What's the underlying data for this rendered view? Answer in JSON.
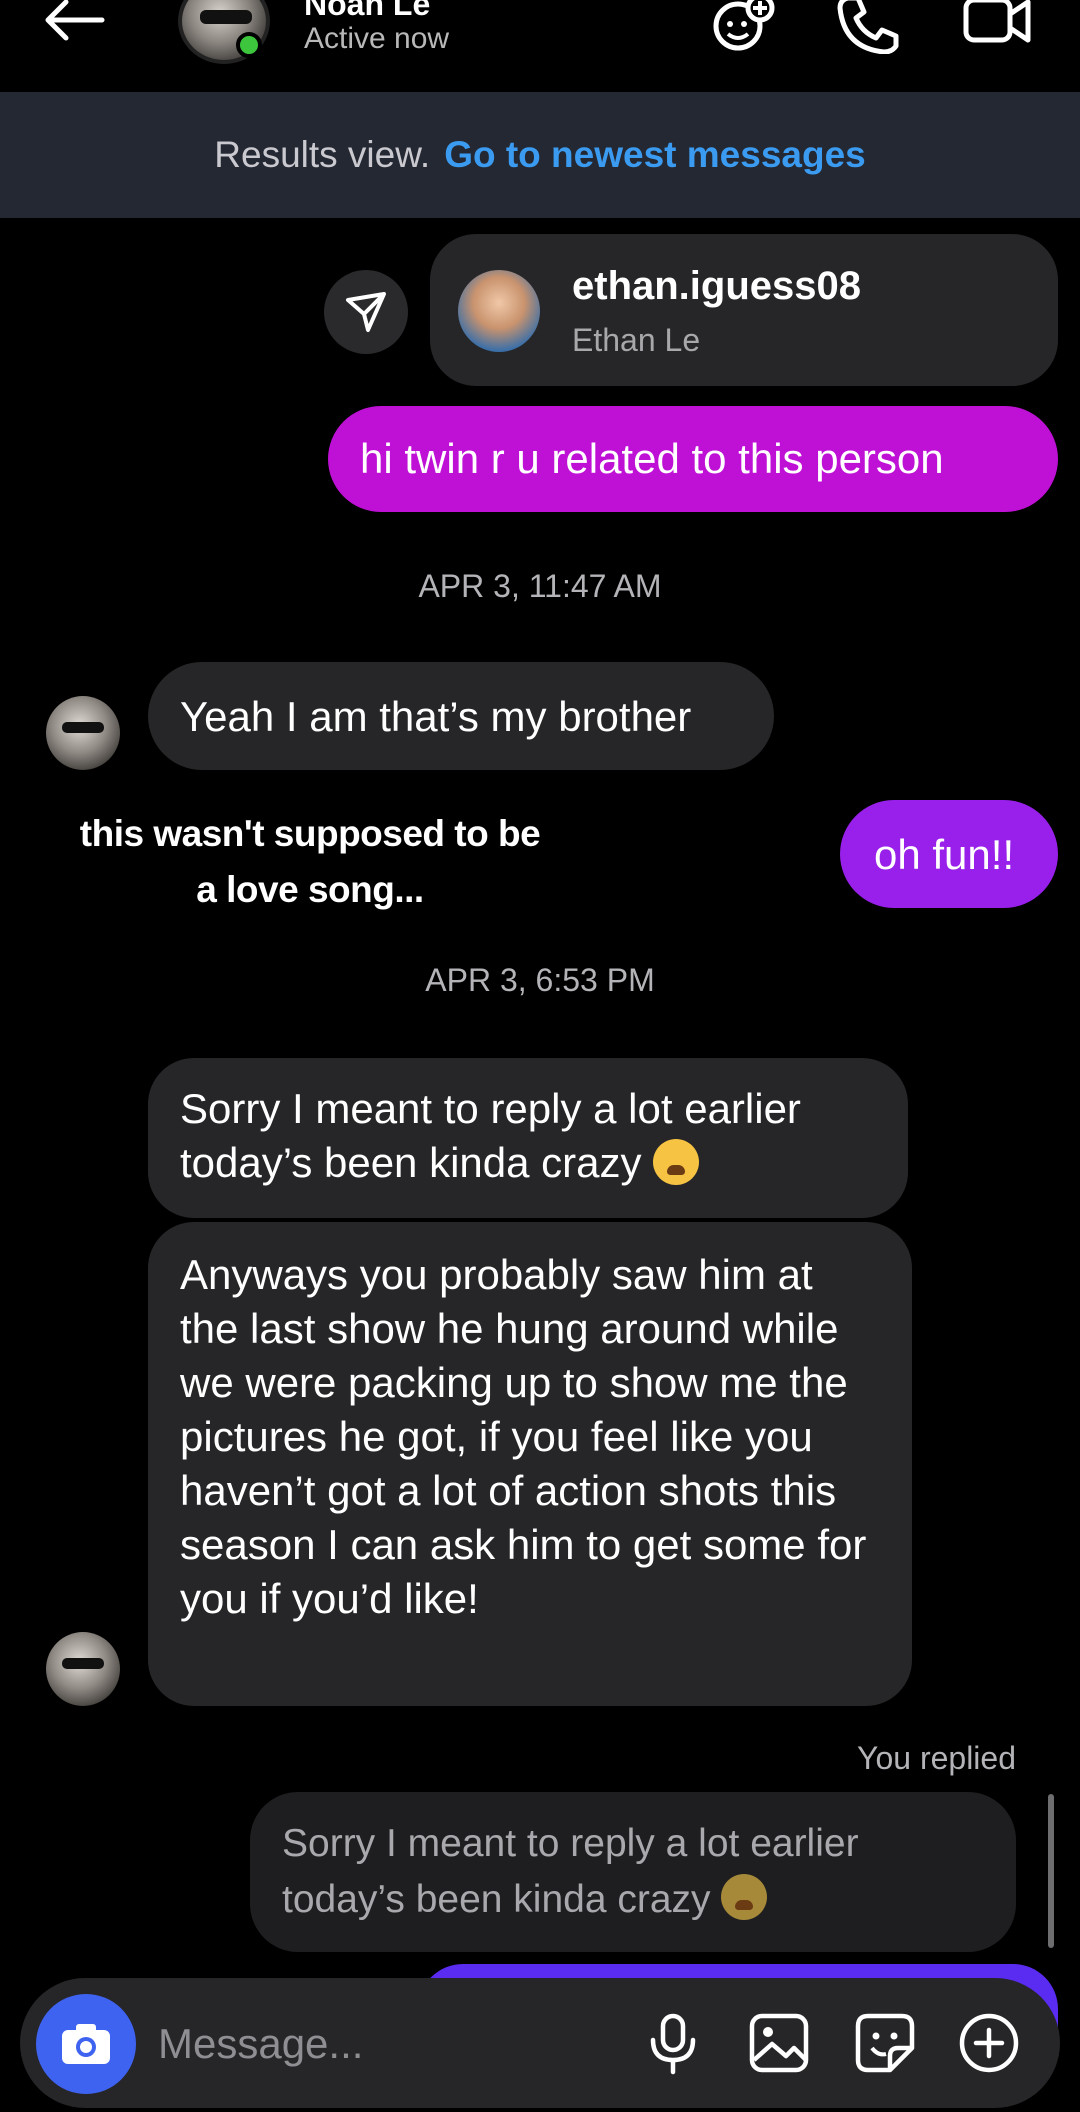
{
  "header": {
    "contact_name": "Noah Le",
    "status": "Active now",
    "icons": [
      "back-arrow-icon",
      "effects-icon",
      "phone-icon",
      "video-camera-icon"
    ]
  },
  "banner": {
    "label": "Results view.",
    "link": "Go to newest messages"
  },
  "shared_profile": {
    "username": "ethan.iguess08",
    "full_name": "Ethan Le"
  },
  "messages": {
    "out1": "hi twin r u related to this person",
    "ts1": "APR 3, 11:47 AM",
    "in1": "Yeah I am that’s my brother",
    "out2": "oh fun!!",
    "ts2": "APR 3, 6:53 PM",
    "in2": "Sorry I meant to reply a lot earlier today’s been kinda crazy",
    "in3": "Anyways you probably saw him at the last show he hung around while we were packing up to show me the pictures he got, if you feel like you haven’t got a lot of action shots this season I can ask him to get some for you if you’d like!",
    "you_replied": "You replied",
    "reply_quote": "Sorry I meant to reply a lot earlier today’s been kinda crazy"
  },
  "overlay_caption": {
    "line1": "this wasn't supposed to be",
    "line2": "a love song..."
  },
  "composer": {
    "placeholder": "Message...",
    "icons": [
      "camera-icon",
      "microphone-icon",
      "gallery-icon",
      "sticker-icon",
      "plus-icon"
    ]
  },
  "colors": {
    "outgoing_magenta": "#bf10d6",
    "outgoing_purple": "#9820ea",
    "incoming": "#262628",
    "link_blue": "#3a9bf0",
    "camera_button": "#3e63f0"
  }
}
